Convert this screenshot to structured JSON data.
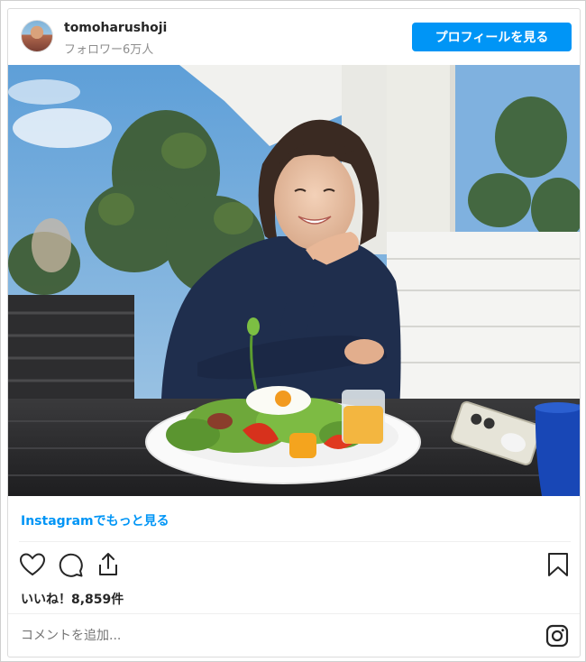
{
  "header": {
    "username": "tomoharushoji",
    "followers": "フォロワー6万人",
    "profile_button": "プロフィールを見る"
  },
  "post": {
    "more_link": "Instagramでもっと見る",
    "likes": "いいね！8,859件",
    "comment_placeholder": "コメントを追加..."
  },
  "icons": {
    "like": "heart-icon",
    "comment": "comment-icon",
    "share": "share-icon",
    "save": "bookmark-icon",
    "instagram": "instagram-icon"
  },
  "colors": {
    "accent": "#0095f6",
    "text": "#262626",
    "muted": "#8e8e8e"
  }
}
